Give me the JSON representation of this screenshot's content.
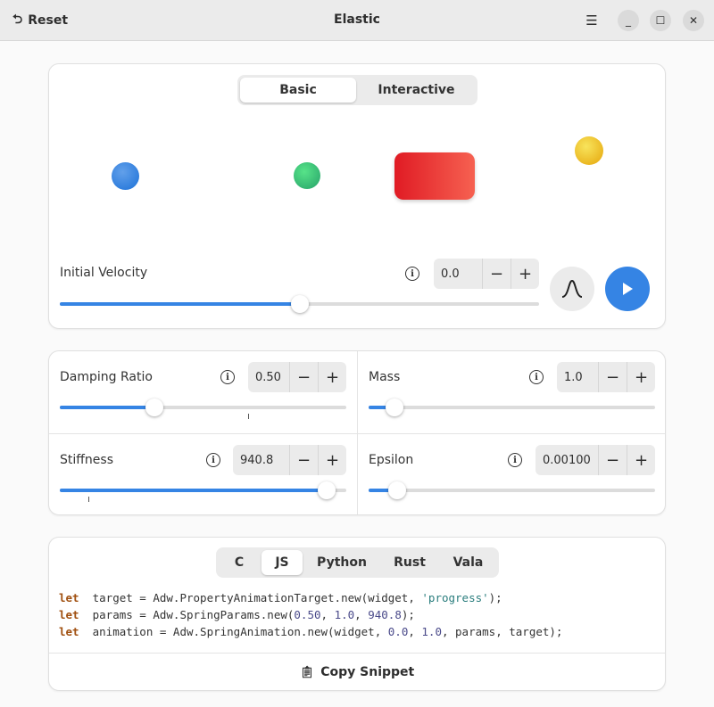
{
  "header": {
    "reset_label": "Reset",
    "title": "Elastic"
  },
  "demo": {
    "tabs": [
      "Basic",
      "Interactive"
    ],
    "active_tab": "Basic"
  },
  "velocity": {
    "label": "Initial Velocity",
    "value": "0.0",
    "slider_fraction": 0.5
  },
  "params": [
    {
      "label": "Damping Ratio",
      "value": "0.50",
      "slider_fraction": 0.33
    },
    {
      "label": "Mass",
      "value": "1.0",
      "slider_fraction": 0.09
    },
    {
      "label": "Stiffness",
      "value": "940.8",
      "slider_fraction": 0.93
    },
    {
      "label": "Epsilon",
      "value": "0.00100",
      "slider_fraction": 0.1
    }
  ],
  "code": {
    "tabs": [
      "C",
      "JS",
      "Python",
      "Rust",
      "Vala"
    ],
    "active_tab": "JS",
    "lines": [
      [
        [
          "kw",
          "let"
        ],
        [
          "",
          "  target = Adw.PropertyAnimationTarget.new(widget, "
        ],
        [
          "str",
          "'progress'"
        ],
        [
          "",
          ");"
        ]
      ],
      [
        [
          "kw",
          "let"
        ],
        [
          "",
          "  params = Adw.SpringParams.new("
        ],
        [
          "num",
          "0.50"
        ],
        [
          "",
          ", "
        ],
        [
          "num",
          "1.0"
        ],
        [
          "",
          ", "
        ],
        [
          "num",
          "940.8"
        ],
        [
          "",
          ");"
        ]
      ],
      [
        [
          "kw",
          "let"
        ],
        [
          "",
          "  animation = Adw.SpringAnimation.new(widget, "
        ],
        [
          "num",
          "0.0"
        ],
        [
          "",
          ", "
        ],
        [
          "num",
          "1.0"
        ],
        [
          "",
          ", params, target);"
        ]
      ]
    ],
    "copy_label": "Copy Snippet"
  },
  "colors": {
    "accent": "#3584e4",
    "blue": "#3584e4",
    "green": "#2ec27e",
    "red": "#e01b24",
    "yellow": "#f6d32d"
  }
}
